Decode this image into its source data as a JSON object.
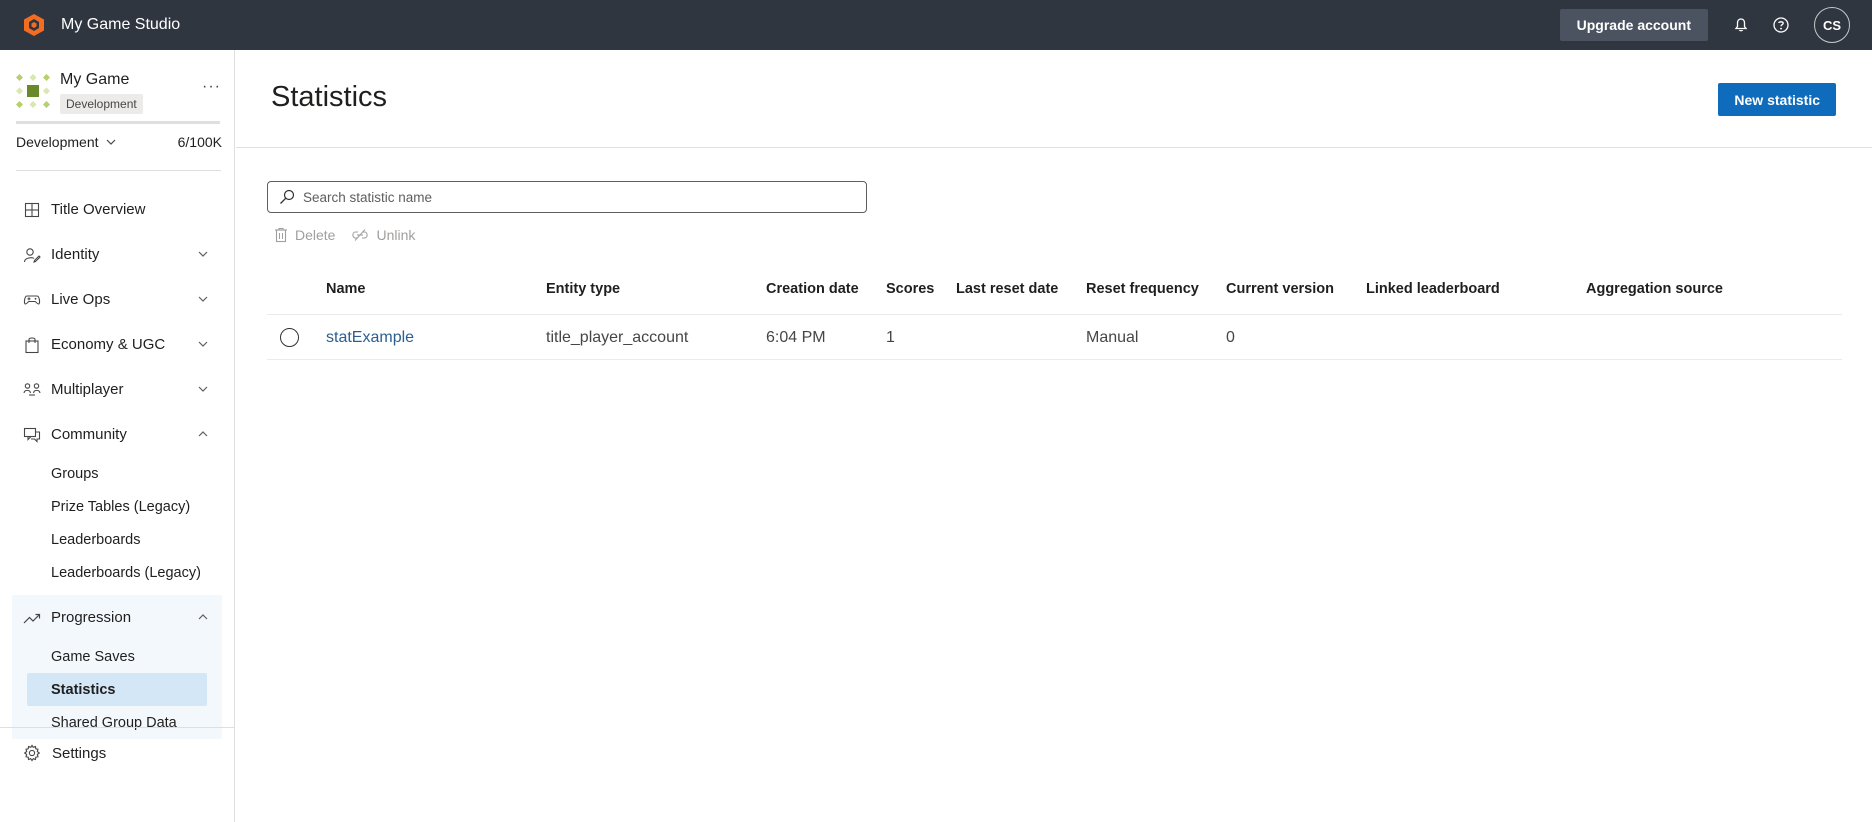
{
  "topbar": {
    "app_title": "My Game Studio",
    "upgrade_label": "Upgrade account",
    "avatar_initials": "CS",
    "brand_color": "#f26c22"
  },
  "sidebar": {
    "game_name": "My Game",
    "game_badge": "Development",
    "more_label": "···",
    "environment": "Development",
    "usage": "6/100K",
    "items": [
      {
        "label": "Title Overview",
        "icon": "grid-icon"
      },
      {
        "label": "Identity",
        "icon": "identity-icon"
      },
      {
        "label": "Live Ops",
        "icon": "gamepad-icon"
      },
      {
        "label": "Economy & UGC",
        "icon": "shopping-bag-icon"
      },
      {
        "label": "Multiplayer",
        "icon": "multiplayer-icon"
      },
      {
        "label": "Community",
        "icon": "chat-icon"
      }
    ],
    "community_sub": [
      "Groups",
      "Prize Tables (Legacy)",
      "Leaderboards",
      "Leaderboards (Legacy)"
    ],
    "progression": {
      "label": "Progression",
      "sub": [
        "Game Saves",
        "Statistics",
        "Shared Group Data"
      ]
    },
    "settings_label": "Settings"
  },
  "main": {
    "title": "Statistics",
    "new_button": "New statistic",
    "search_placeholder": "Search statistic name",
    "delete_label": "Delete",
    "unlink_label": "Unlink",
    "columns": [
      "Name",
      "Entity type",
      "Creation date",
      "Scores",
      "Last reset date",
      "Reset frequency",
      "Current version",
      "Linked leaderboard",
      "Aggregation source"
    ],
    "rows": [
      {
        "name": "statExample",
        "entity_type": "title_player_account",
        "creation_date": "6:04 PM",
        "scores": "1",
        "last_reset": "",
        "reset_frequency": "Manual",
        "current_version": "0",
        "linked_leaderboard": "",
        "aggregation_source": ""
      }
    ]
  }
}
